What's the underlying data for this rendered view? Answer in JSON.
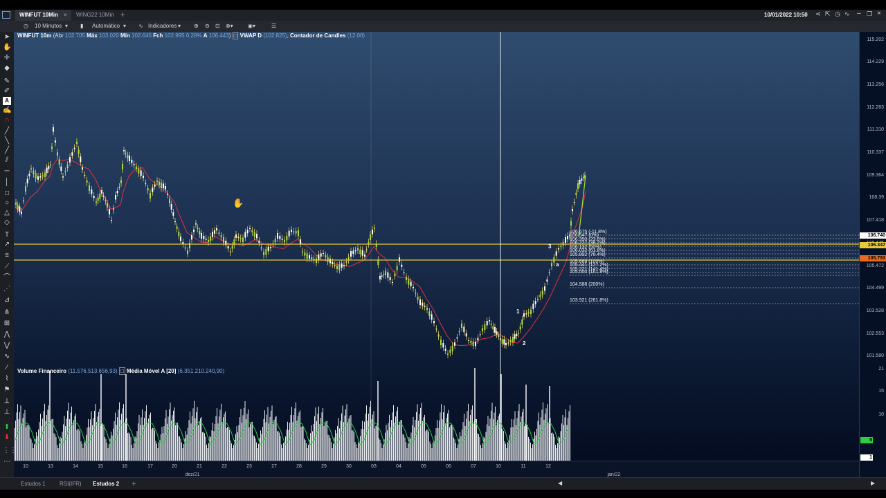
{
  "titlebar": {
    "tabs": [
      {
        "label": "WINFUT 10Min",
        "active": true
      },
      {
        "label": "WING22 10Min",
        "active": false
      }
    ],
    "add_tab": "+",
    "datetime": "10/01/2022 10:50"
  },
  "toolbar": {
    "interval": "10 Minutos",
    "scale_mode": "Automático",
    "indicators": "Indicadores"
  },
  "legend": {
    "symbol": "WINFUT 10m",
    "abr_label": "Abr",
    "abr": "102.705",
    "max_label": "Máx",
    "max": "103.020",
    "min_label": "Mín",
    "min": "102.645",
    "fch_label": "Fch",
    "fch": "102.995",
    "change": "0.28%",
    "a_label": "A",
    "a": "106.443",
    "vwap_label": "VWAP D",
    "vwap": "(102.825)",
    "candles_label": "Contador de Candles",
    "candles": "(12.00)"
  },
  "volume_legend": {
    "label": "Volume Financeiro",
    "value": "(11.576.513.656,93)",
    "ma_label": "Média Móvel A [20]",
    "ma_value": "(6.351.210.240,90)"
  },
  "price_axis": [
    "115.202",
    "114.229",
    "113.256",
    "112.283",
    "111.310",
    "110.337",
    "109.364",
    "108.39",
    "107.418",
    "106.445",
    "105.472",
    "104.499",
    "103.528",
    "102.553",
    "101.580"
  ],
  "price_badges": [
    {
      "value": "106.740",
      "color": "#ffffff",
      "text": "#000000"
    },
    {
      "value": "106.347",
      "color": "#e8c93a",
      "text": "#000000"
    },
    {
      "value": "105.793",
      "color": "#e86a1c",
      "text": "#000000"
    }
  ],
  "volume_axis": [
    "21",
    "15",
    "10"
  ],
  "volume_badges": [
    {
      "value": "5",
      "color": "#2ecc40"
    },
    {
      "value": "1",
      "color": "#ffffff"
    }
  ],
  "fib_levels": [
    "106.675 (-11.8%)",
    "106.547 (0%)",
    "106.350 (23.6%)",
    "106.227 (38.2%)",
    "106.132 (50%)",
    "106.032 (61.8%)",
    "105.892 (76.4%)",
    "105.668 (100%)",
    "105.441 (127.2%)",
    "105.221 (141.4%)",
    "105.000 (161.8%)",
    "104.588 (200%)",
    "103.921 (261.8%)"
  ],
  "x_axis": {
    "days": [
      "10",
      "13",
      "14",
      "15",
      "16",
      "17",
      "20",
      "21",
      "22",
      "23",
      "27",
      "28",
      "29",
      "30",
      "03",
      "04",
      "05",
      "06",
      "07",
      "10",
      "11",
      "12"
    ],
    "months": [
      "dez/21",
      "jan/22"
    ]
  },
  "wave_labels": [
    "1",
    "2",
    "3",
    "a"
  ],
  "bottom_tabs": [
    {
      "label": "Estudos 1",
      "active": false
    },
    {
      "label": "RSI(IFR)",
      "active": false
    },
    {
      "label": "Estudos 2",
      "active": true
    },
    {
      "label": "+",
      "active": false
    }
  ],
  "colors": {
    "candle_up": "#a6e22e",
    "candle_down": "#ffffff",
    "wick": "#ffe25a",
    "moving_average": "#e0303a",
    "h_line": "#e8c93a",
    "volume": "#e9ecef",
    "volume_ma": "#2ecc40"
  }
}
